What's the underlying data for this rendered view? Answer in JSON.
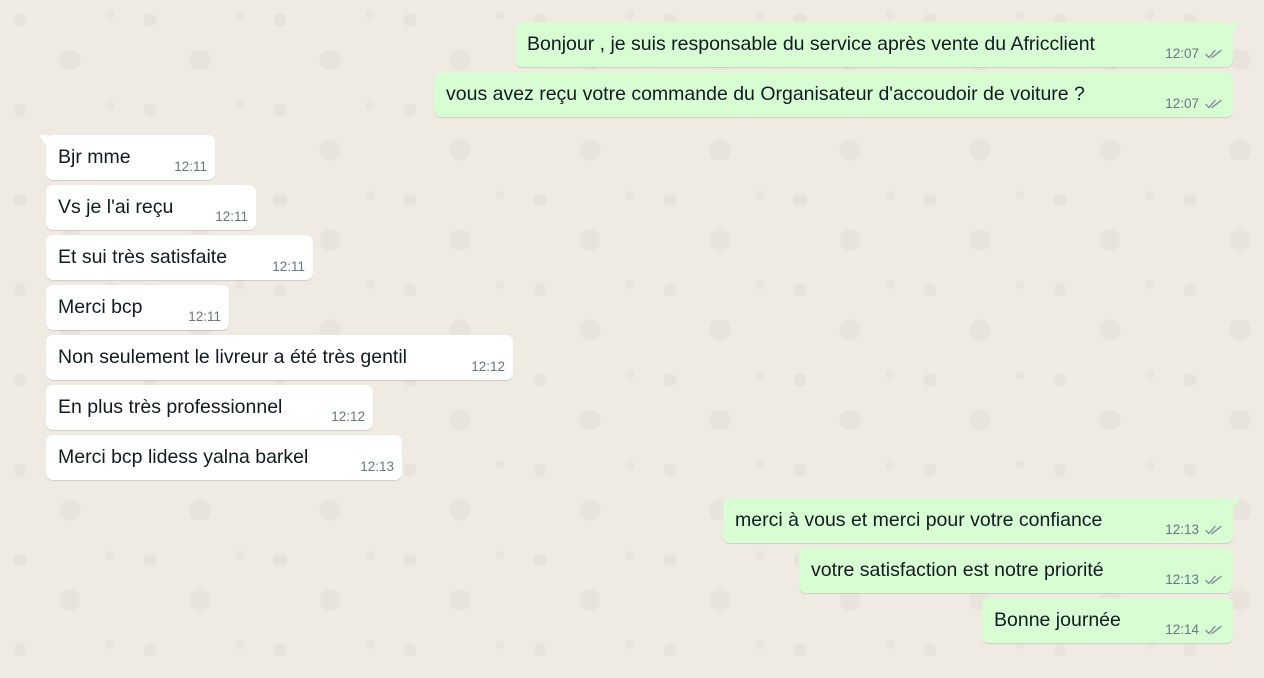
{
  "conversation": {
    "messages": [
      {
        "direction": "out",
        "text": "Bonjour , je suis responsable du service après vente du Africclient",
        "time": "12:07",
        "status": "read-double-check-icon"
      },
      {
        "direction": "out",
        "text": "vous avez reçu votre commande du Organisateur d'accoudoir de voiture ?",
        "time": "12:07",
        "status": "read-double-check-icon"
      },
      {
        "direction": "in",
        "text": "Bjr mme",
        "time": "12:11"
      },
      {
        "direction": "in",
        "text": "Vs je l'ai reçu",
        "time": "12:11"
      },
      {
        "direction": "in",
        "text": "Et sui très satisfaite",
        "time": "12:11"
      },
      {
        "direction": "in",
        "text": "Merci bcp",
        "time": "12:11"
      },
      {
        "direction": "in",
        "text": "Non seulement le livreur a été très gentil",
        "time": "12:12"
      },
      {
        "direction": "in",
        "text": "En plus très professionnel",
        "time": "12:12"
      },
      {
        "direction": "in",
        "text": "Merci bcp lidess yalna barkel",
        "time": "12:13"
      },
      {
        "direction": "out",
        "text": "merci à vous et merci pour votre confiance",
        "time": "12:13",
        "status": "read-double-check-icon"
      },
      {
        "direction": "out",
        "text": "votre satisfaction est notre priorité",
        "time": "12:13",
        "status": "read-double-check-icon"
      },
      {
        "direction": "out",
        "text": "Bonne journée",
        "time": "12:14",
        "status": "read-double-check-icon"
      }
    ]
  },
  "colors": {
    "background": "#efeae2",
    "outgoing_bubble": "#d9fdd3",
    "incoming_bubble": "#ffffff",
    "timestamp": "#667781",
    "ticks": "#8696a0"
  }
}
